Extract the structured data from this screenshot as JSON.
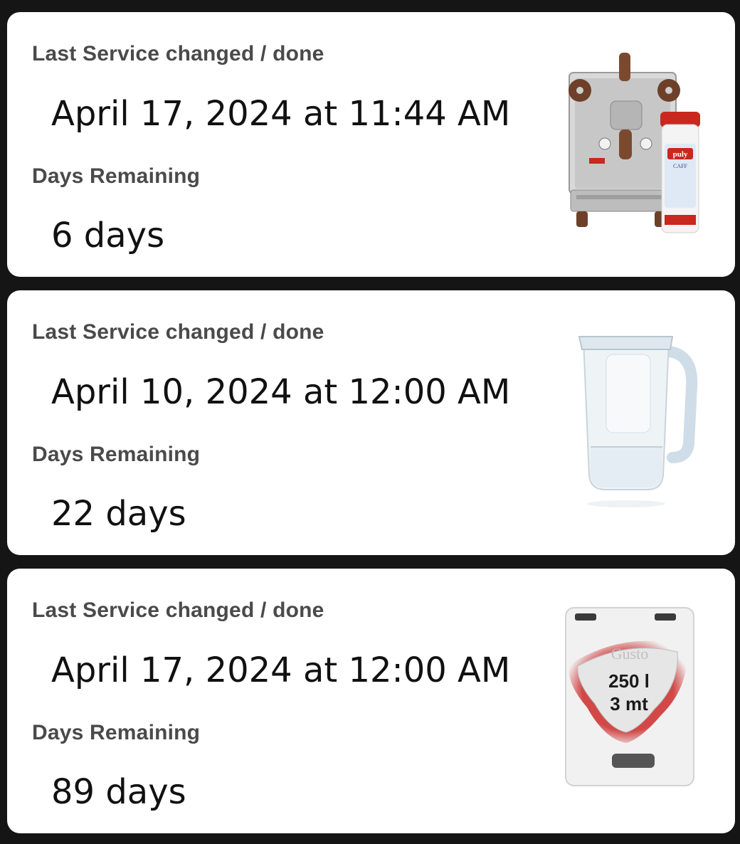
{
  "cards": [
    {
      "label_last_service": "Last Service changed / done",
      "last_service": "April 17, 2024 at 11:44 AM",
      "label_days_remaining": "Days Remaining",
      "days_remaining": "6 days",
      "image": "espresso-machine-with-cleaner-icon",
      "brand_text": "puly",
      "brand_sub": "CAFF"
    },
    {
      "label_last_service": "Last Service changed / done",
      "last_service": "April 10, 2024 at 12:00 AM",
      "label_days_remaining": "Days Remaining",
      "days_remaining": "22 days",
      "image": "water-filter-jug-icon"
    },
    {
      "label_last_service": "Last Service changed / done",
      "last_service": "April 17, 2024 at 12:00 AM",
      "label_days_remaining": "Days Remaining",
      "days_remaining": "89 days",
      "image": "water-softener-filter-icon",
      "filter_capacity": "250 l",
      "filter_duration": "3 mt",
      "filter_brand": "Gusto"
    }
  ],
  "colors": {
    "background": "#151515",
    "card": "#ffffff",
    "label": "#4a4a4a",
    "value": "#111111",
    "filter_glow": "#cc2a2a",
    "puly_red": "#c8281e"
  }
}
